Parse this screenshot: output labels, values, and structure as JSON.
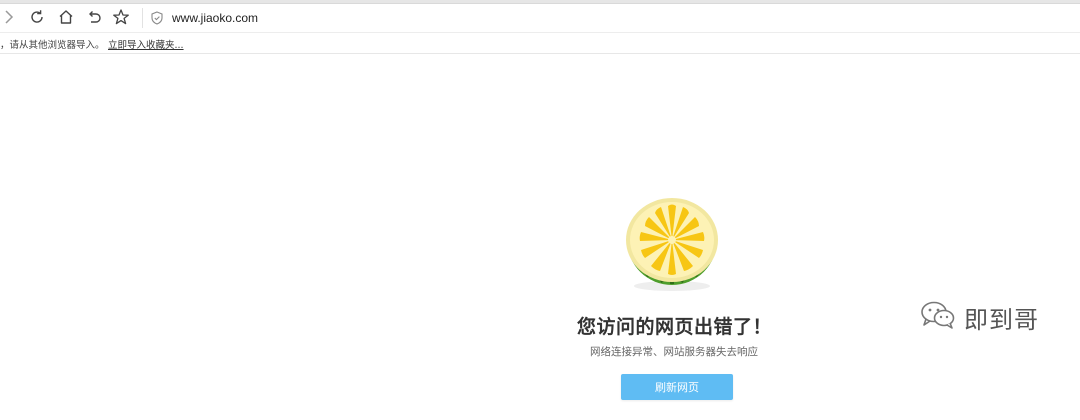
{
  "browser": {
    "address_url": "www.jiaoko.com"
  },
  "bookmark_bar": {
    "hint_text": "，请从其他浏览器导入。",
    "import_link": "立即导入收藏夹..."
  },
  "error_page": {
    "title": "您访问的网页出错了！",
    "subtitle": "网络连接异常、网站服务器失去响应",
    "refresh_button": "刷新网页"
  },
  "watermark": {
    "text": "即到哥"
  },
  "colors": {
    "refresh_button_bg": "#5fbcf3",
    "lemon_flesh": "#f7c614",
    "lemon_rind_green": "#4f9e2c"
  },
  "icons": {
    "forward": "chevron-right-icon",
    "reload": "reload-icon",
    "home": "home-icon",
    "undo": "undo-icon",
    "favorite": "star-icon",
    "security": "shield-icon",
    "error_illustration": "lemon-icon",
    "watermark_logo": "wechat-icon"
  }
}
